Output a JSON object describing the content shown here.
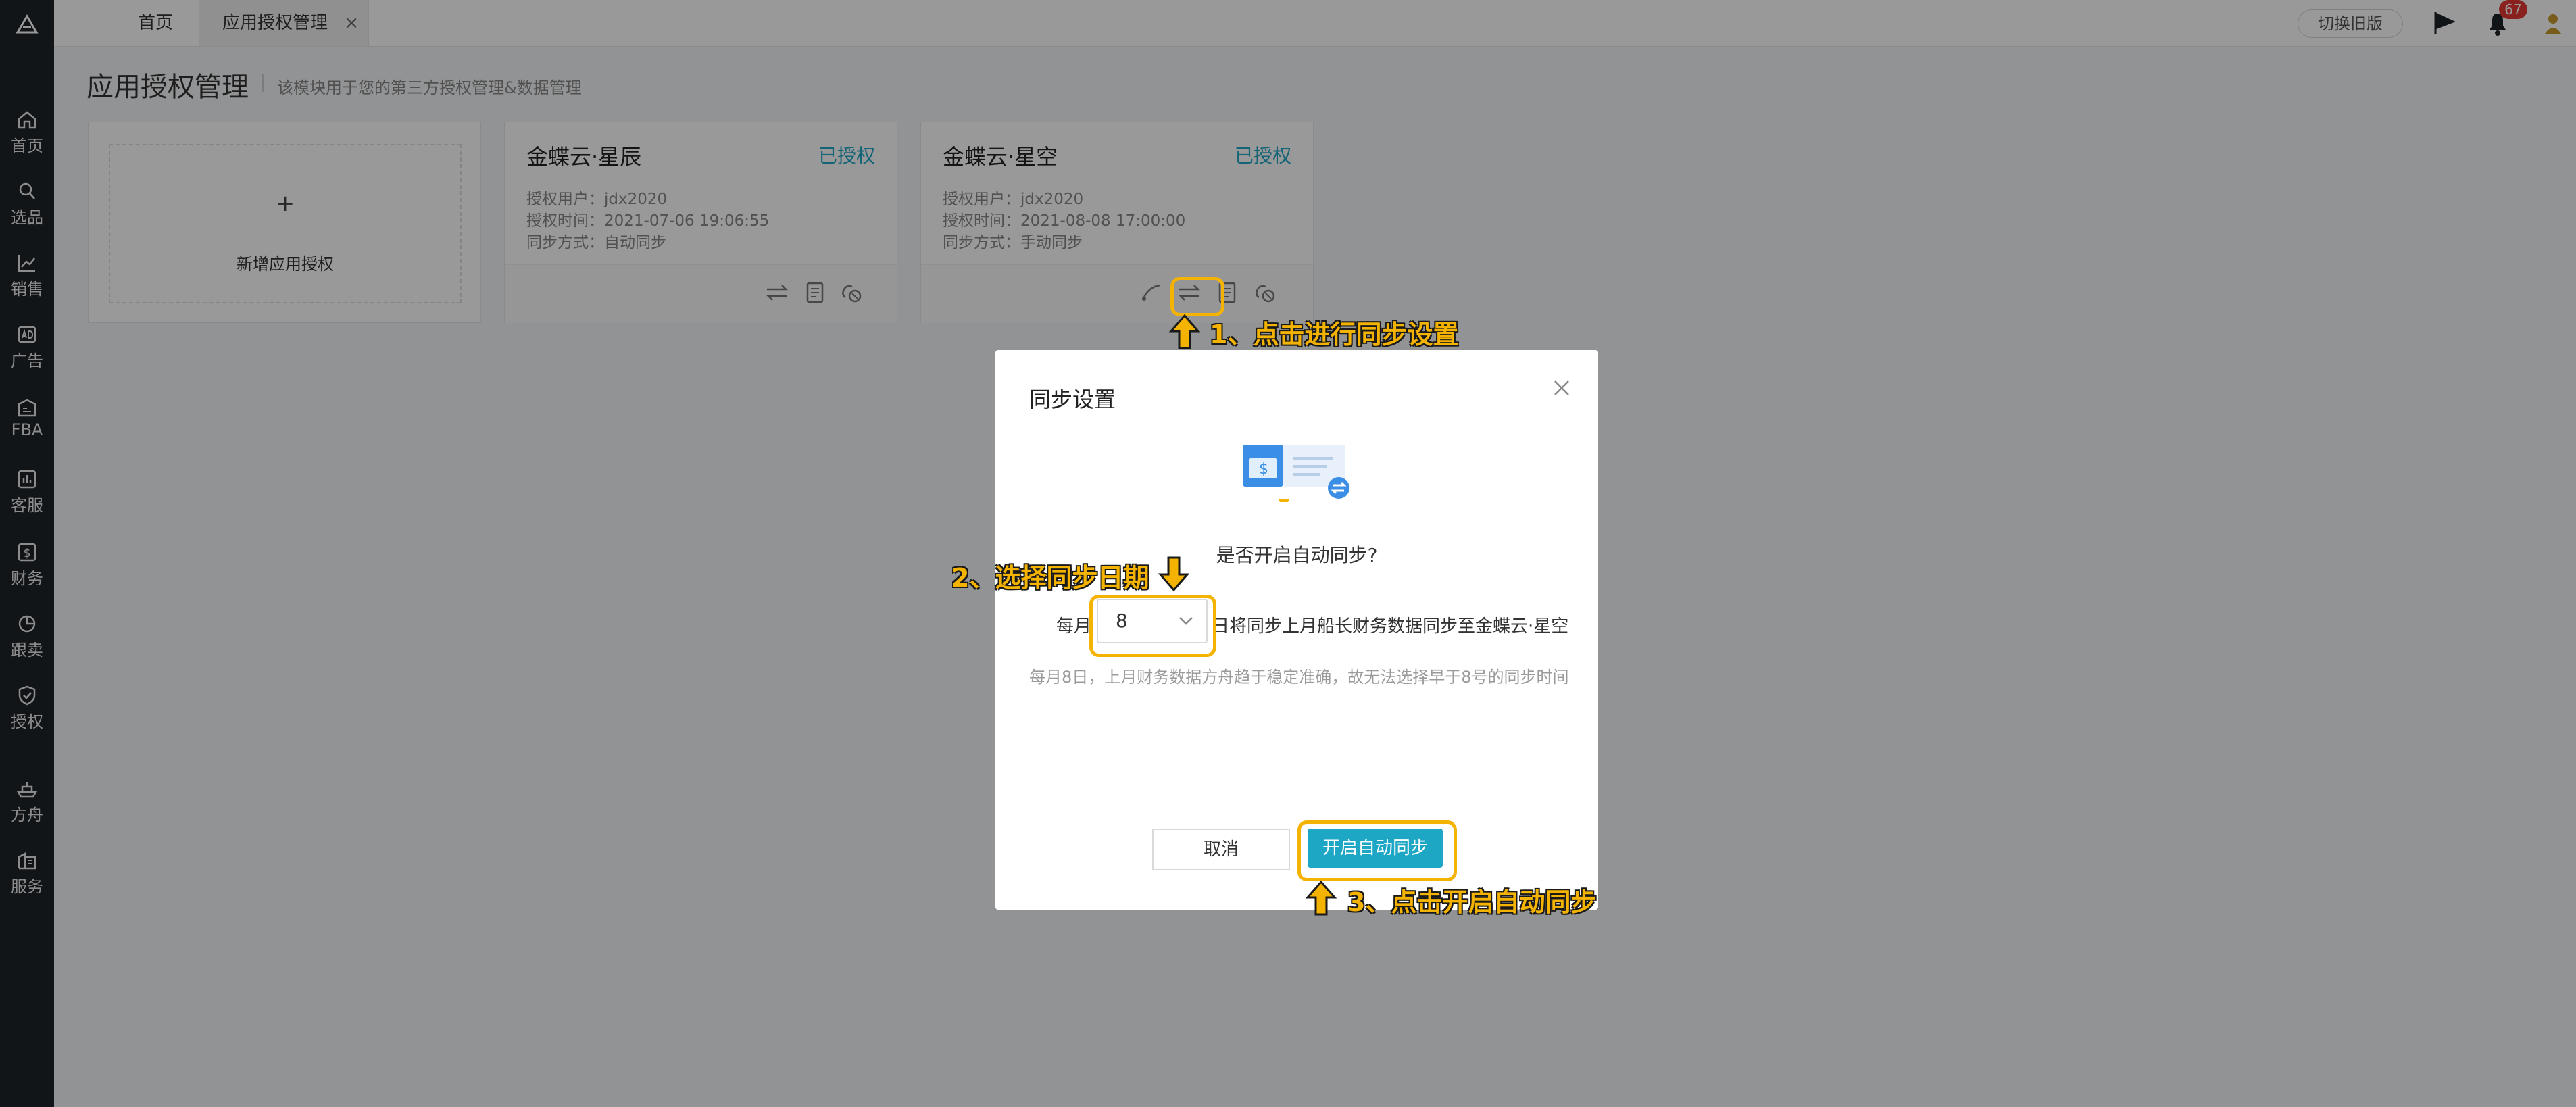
{
  "colors": {
    "accent": "#1ea7c5",
    "annotation": "#f5b301",
    "sidebar_bg": "#1f2329",
    "badge": "#e53935"
  },
  "sidebar": {
    "logo_icon": "logo-icon",
    "items": [
      {
        "label": "首页",
        "icon": "home-icon"
      },
      {
        "label": "选品",
        "icon": "search-icon"
      },
      {
        "label": "销售",
        "icon": "chart-line-icon"
      },
      {
        "label": "广告",
        "icon": "ad-icon"
      },
      {
        "label": "FBA",
        "icon": "warehouse-icon"
      },
      {
        "label": "客服",
        "icon": "chart-bar-icon"
      },
      {
        "label": "财务",
        "icon": "dollar-icon"
      },
      {
        "label": "跟卖",
        "icon": "pie-chart-icon"
      },
      {
        "label": "授权",
        "icon": "shield-icon"
      },
      {
        "label": "方舟",
        "icon": "ship-icon"
      },
      {
        "label": "服务",
        "icon": "building-icon"
      }
    ]
  },
  "topbar": {
    "tabs": [
      {
        "label": "首页"
      },
      {
        "label": "应用授权管理",
        "close": "×"
      }
    ],
    "switch_old_label": "切换旧版",
    "notification_count": "67"
  },
  "page": {
    "title": "应用授权管理",
    "description": "该模块用于您的第三方授权管理&数据管理"
  },
  "cards": {
    "add": {
      "plus": "+",
      "label": "新增应用授权"
    },
    "items": [
      {
        "title": "金蝶云·星辰",
        "status": "已授权",
        "user": "授权用户：jdx2020",
        "time": "授权时间：2021-07-06 19:06:55",
        "sync": "同步方式：自动同步"
      },
      {
        "title": "金蝶云·星空",
        "status": "已授权",
        "user": "授权用户：jdx2020",
        "time": "授权时间：2021-08-08 17:00:00",
        "sync": "同步方式：手动同步"
      }
    ]
  },
  "modal": {
    "title": "同步设置",
    "question": "是否开启自动同步?",
    "prefix": "每月",
    "day_value": "8",
    "suffix": "日将同步上月船长财务数据同步至金蝶云·星空",
    "hint": "每月8日，上月财务数据方舟趋于稳定准确，故无法选择早于8号的同步时间",
    "cancel_label": "取消",
    "confirm_label": "开启自动同步"
  },
  "annotations": {
    "step1": "1、点击进行同步设置",
    "step2": "2、选择同步日期",
    "step3": "3、点击开启自动同步"
  }
}
